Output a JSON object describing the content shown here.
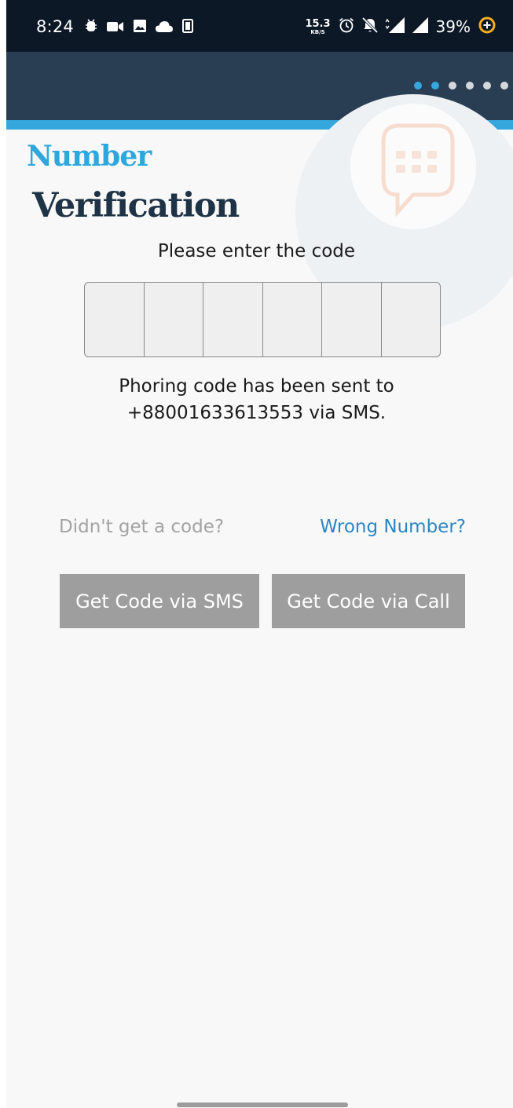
{
  "status_bar": {
    "time": "8:24",
    "network_speed_value": "15.3",
    "network_speed_unit": "KB/S",
    "network_type": "H+",
    "battery_percent": "39%",
    "icons_left": [
      "usb-debug-icon",
      "video-camera-icon",
      "image-icon",
      "cloud-icon",
      "screenshot-icon"
    ],
    "icons_right": [
      "alarm-icon",
      "bell-off-icon",
      "mobile-signal-icon",
      "wifi-signal-icon",
      "battery-saver-icon"
    ]
  },
  "onboarding": {
    "total_steps": 6,
    "current_step": 2
  },
  "page": {
    "title_line1": "Number",
    "title_line2": "Verification",
    "prompt": "Please enter the code",
    "code_digits": [
      "",
      "",
      "",
      "",
      "",
      ""
    ],
    "sent_message_line1": "Phoring code has been sent to",
    "sent_message_line2": "+88001633613553 via SMS.",
    "no_code_text": "Didn't get a code?",
    "wrong_number_link": "Wrong Number?",
    "sms_button": "Get Code via SMS",
    "call_button": "Get Code via Call"
  },
  "colors": {
    "status_bar": "#0d1826",
    "app_bar": "#2a3e53",
    "accent": "#35a7dc",
    "title_primary": "#2ea7dd",
    "title_secondary": "#1f3346",
    "link": "#2c86c4",
    "button_disabled": "#9e9e9e"
  }
}
